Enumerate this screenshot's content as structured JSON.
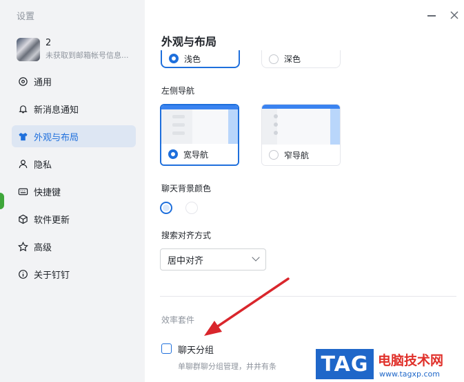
{
  "sidebar": {
    "title": "设置",
    "profile": {
      "name": "2",
      "subtitle": "未获取到邮箱帐号信息..."
    },
    "items": [
      {
        "label": "通用",
        "icon": "gear-icon"
      },
      {
        "label": "新消息通知",
        "icon": "bell-icon"
      },
      {
        "label": "外观与布局",
        "icon": "shirt-icon",
        "active": true
      },
      {
        "label": "隐私",
        "icon": "person-icon"
      },
      {
        "label": "快捷键",
        "icon": "keyboard-icon"
      },
      {
        "label": "软件更新",
        "icon": "cube-icon"
      },
      {
        "label": "高级",
        "icon": "star-icon"
      },
      {
        "label": "关于钉钉",
        "icon": "info-icon"
      }
    ]
  },
  "main": {
    "title": "外观与布局",
    "theme": {
      "light_label": "浅色",
      "dark_label": "深色",
      "selected": "light"
    },
    "left_nav": {
      "label": "左侧导航",
      "wide_label": "宽导航",
      "narrow_label": "窄导航",
      "selected": "wide"
    },
    "chat_bg": {
      "label": "聊天背景颜色",
      "colors": [
        "#dbe9fb",
        "#ffffff"
      ],
      "selected_index": 0
    },
    "search_align": {
      "label": "搜索对齐方式",
      "value": "居中对齐"
    },
    "efficiency": {
      "title": "效率套件",
      "chat_group_label": "聊天分组",
      "chat_group_desc": "单聊群聊分组管理，井井有条",
      "checked": false
    }
  },
  "watermark": {
    "tag": "TAG",
    "site_name": "电脑技术网",
    "url": "www.tagxp.com"
  },
  "colors": {
    "accent": "#1e6fdc",
    "sidebar_bg": "#f2f3f5",
    "arrow": "#d9262c"
  }
}
